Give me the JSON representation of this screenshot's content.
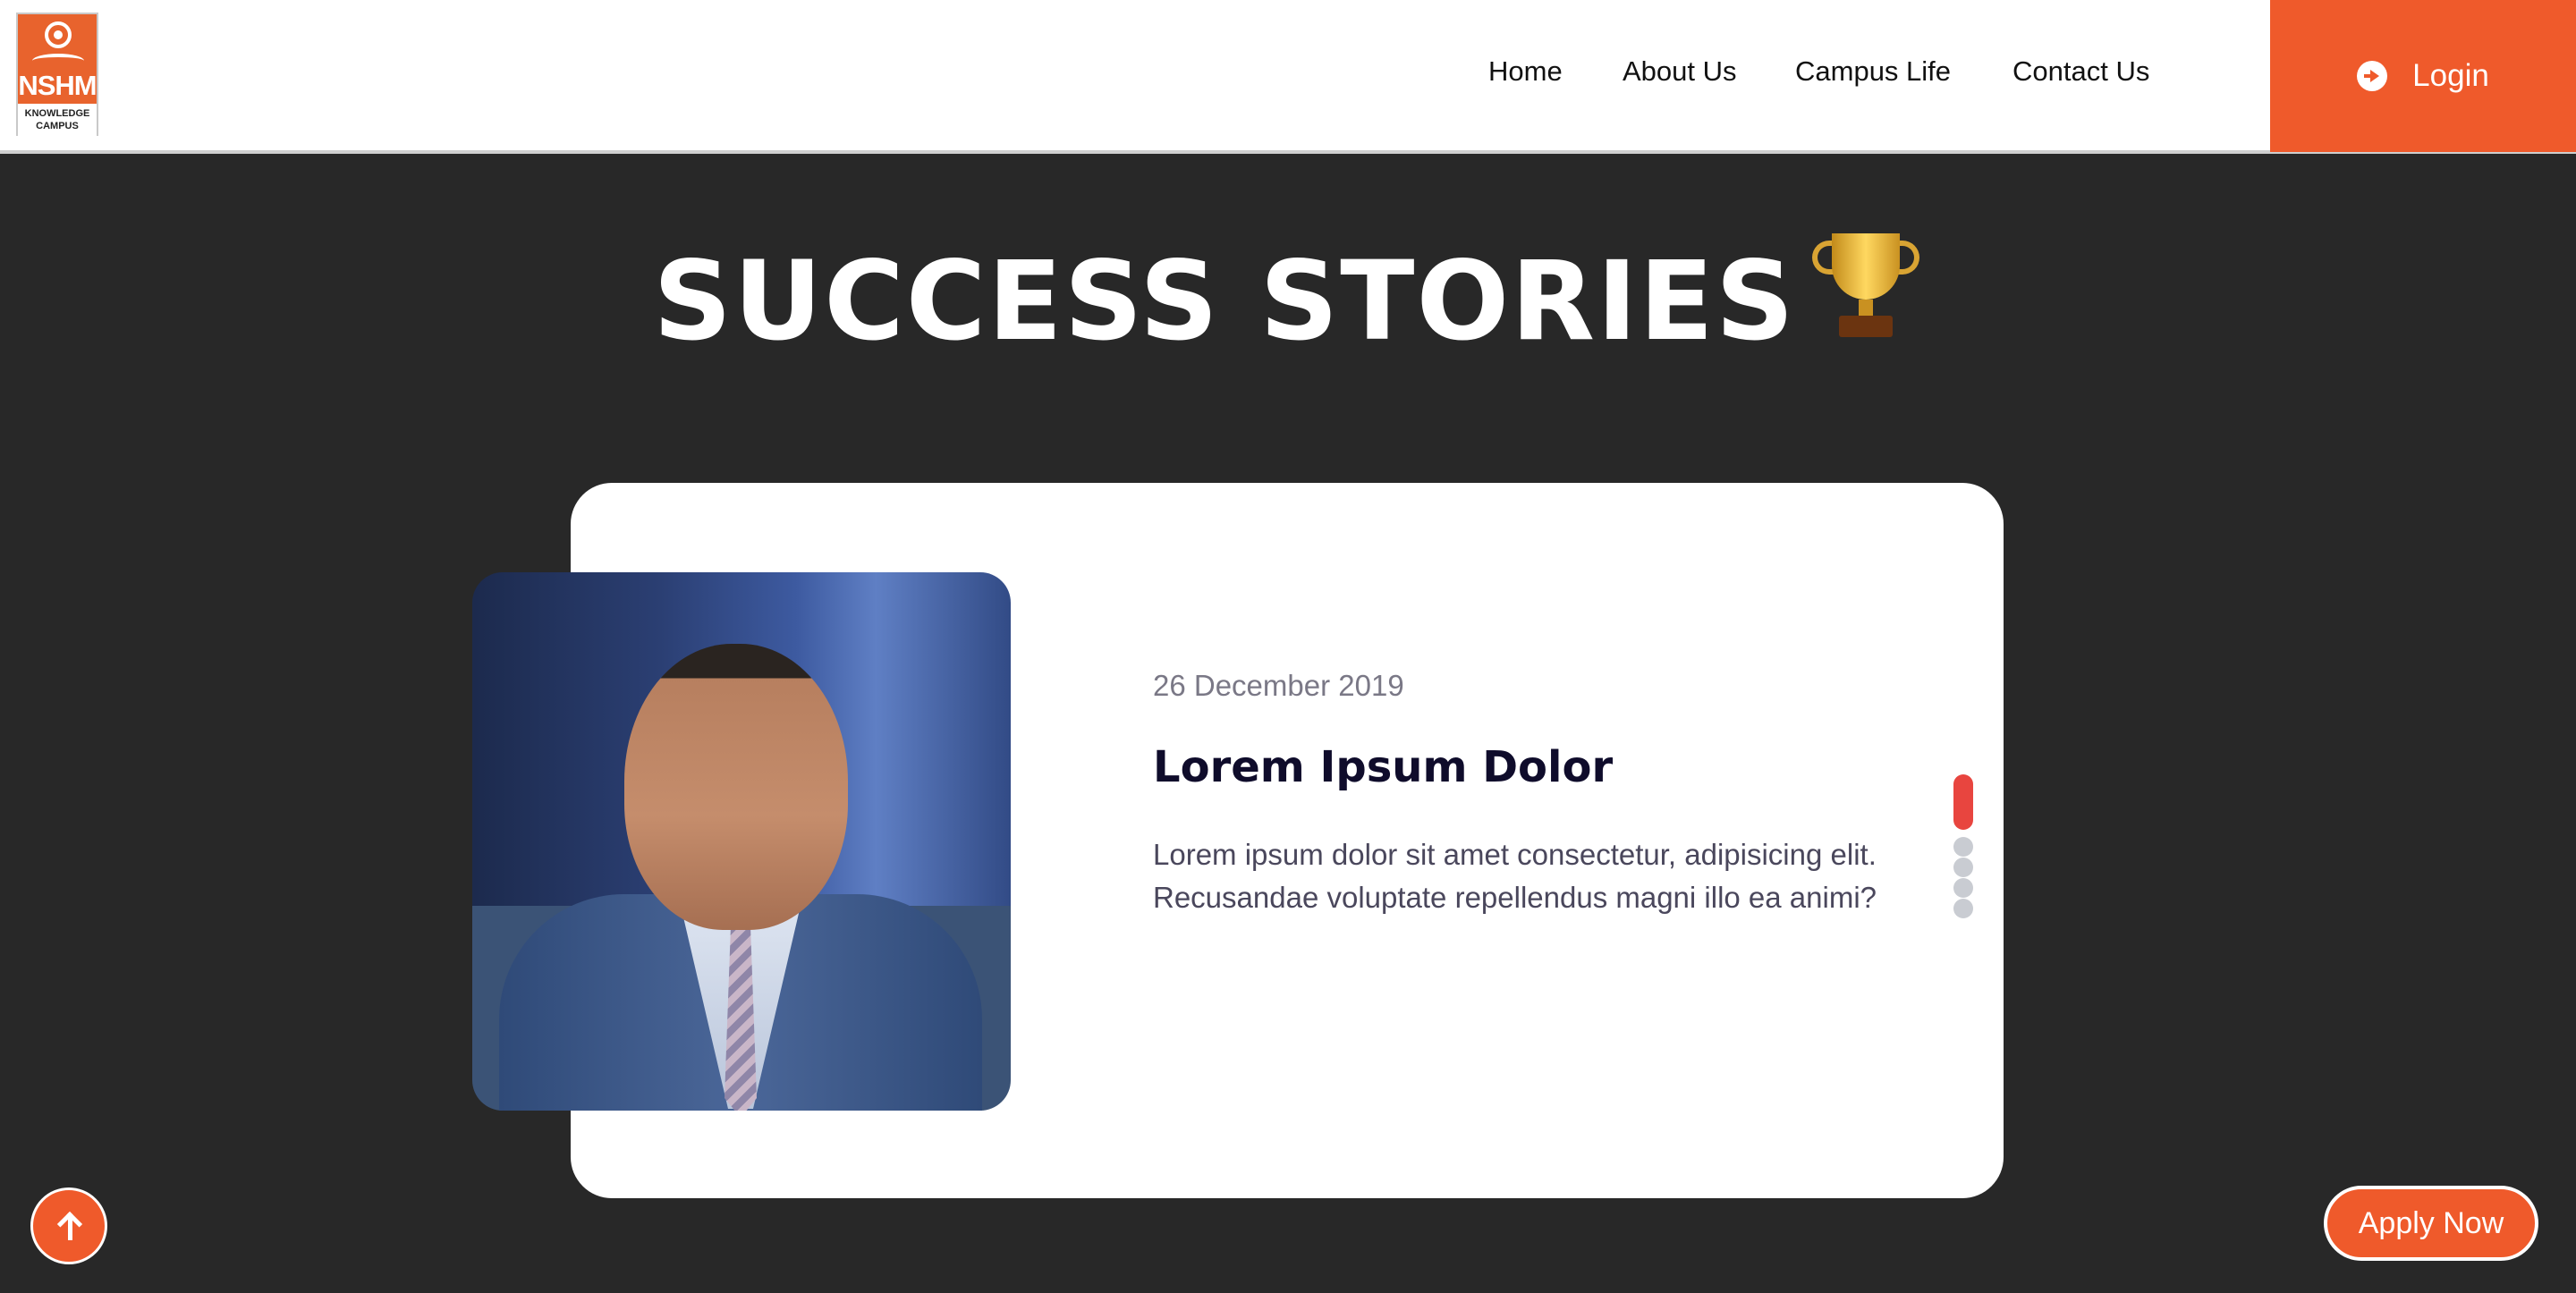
{
  "header": {
    "logo": {
      "text": "NSHM",
      "subtext": "KNOWLEDGE CAMPUS"
    },
    "nav": [
      {
        "label": "Home"
      },
      {
        "label": "About Us"
      },
      {
        "label": "Campus Life"
      },
      {
        "label": "Contact Us"
      }
    ],
    "login_label": "Login",
    "login_icon": "arrow-circle-right-icon"
  },
  "section": {
    "title": "SUCCESS STORIES",
    "title_icon": "trophy-icon"
  },
  "story": {
    "date": "26 December 2019",
    "heading": "Lorem Ipsum Dolor",
    "text": "Lorem ipsum dolor sit amet consectetur, adipisicing elit. Recusandae voluptate repellendus magni illo ea animi?",
    "pager": {
      "total": 5,
      "active_index": 0
    }
  },
  "floating": {
    "scroll_top_icon": "arrow-up-icon",
    "apply_label": "Apply Now"
  },
  "colors": {
    "accent": "#ef5a2b",
    "background": "#282828",
    "card": "#ffffff",
    "pager_active": "#e8453f",
    "pager_inactive": "#c9ccd2"
  }
}
